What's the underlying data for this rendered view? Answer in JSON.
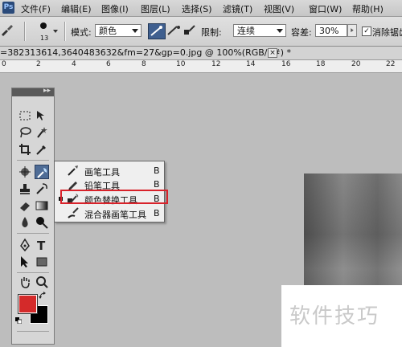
{
  "menubar": {
    "items": [
      "文件(F)",
      "编辑(E)",
      "图像(I)",
      "图层(L)",
      "选择(S)",
      "滤镜(T)",
      "视图(V)",
      "窗口(W)",
      "帮助(H)"
    ]
  },
  "options": {
    "brush_size": "13",
    "mode_label": "模式:",
    "mode_value": "颜色",
    "limit_label": "限制:",
    "limit_value": "连续",
    "tolerance_label": "容差:",
    "tolerance_value": "30%",
    "antialias_label": "消除锯齿",
    "antialias_checked": true
  },
  "document": {
    "tab_title": "=382313614,3640483632&fm=27&gp=0.jpg @ 100%(RGB/8#) *",
    "close_glyph": "×"
  },
  "ruler": {
    "labels": [
      "0",
      "2",
      "4",
      "6",
      "8",
      "10",
      "12",
      "14",
      "16",
      "18",
      "20",
      "22"
    ]
  },
  "toolpanel": {
    "header_glyph": "▸▸",
    "foreground_color": "#d42a2a",
    "background_color": "#000000"
  },
  "flyout": {
    "items": [
      {
        "label": "画笔工具",
        "key": "B",
        "icon": "brush-icon",
        "selected": false
      },
      {
        "label": "铅笔工具",
        "key": "B",
        "icon": "pencil-icon",
        "selected": false
      },
      {
        "label": "颜色替换工具",
        "key": "B",
        "icon": "color-replacement-icon",
        "selected": true
      },
      {
        "label": "混合器画笔工具",
        "key": "B",
        "icon": "mixer-brush-icon",
        "selected": false
      }
    ],
    "highlight_color": "#d8222a"
  },
  "watermark": {
    "text": "软件技巧"
  }
}
